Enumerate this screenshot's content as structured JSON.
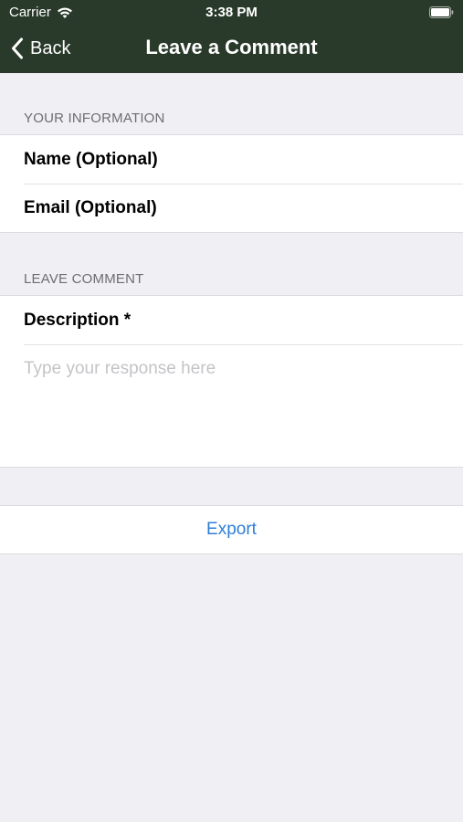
{
  "status_bar": {
    "carrier": "Carrier",
    "time": "3:38 PM"
  },
  "nav": {
    "back_label": "Back",
    "title": "Leave a Comment"
  },
  "sections": {
    "your_information": {
      "header": "YOUR INFORMATION",
      "rows": [
        "Name (Optional)",
        "Email (Optional)"
      ]
    },
    "leave_comment": {
      "header": "LEAVE COMMENT",
      "description_label": "Description *",
      "response_placeholder": "Type your response here"
    }
  },
  "actions": {
    "export_label": "Export"
  },
  "colors": {
    "nav_background": "#293a2a",
    "page_background": "#f0f0f4",
    "accent": "#2f7fd6"
  },
  "icons": [
    "wifi-icon",
    "battery-icon",
    "chevron-left-icon"
  ]
}
